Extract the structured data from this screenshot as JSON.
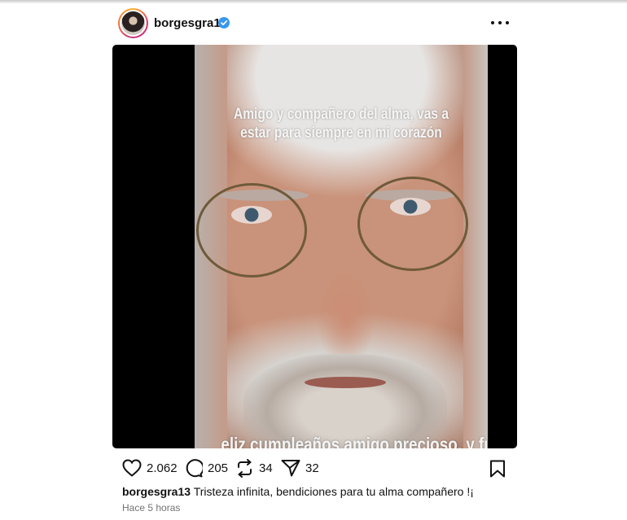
{
  "post": {
    "username": "borgesgra13",
    "verified_color": "#3897f0",
    "media": {
      "overlay_top": "Amigo y compañero del alma, vas a estar para siempre en mi corazón",
      "overlay_bottom": "eliz cumpleaños amigo precioso, y fuerza!!"
    },
    "actions": {
      "likes": "2.062",
      "comments": "205",
      "reposts": "34",
      "shares": "32"
    },
    "caption": {
      "username": "borgesgra13",
      "text": "Tristeza infinita, bendiciones para tu alma compañero !¡"
    },
    "time": "Hace 5 horas"
  },
  "icons": [
    "more-icon",
    "verified-icon",
    "heart-icon",
    "comment-icon",
    "repost-icon",
    "share-icon",
    "bookmark-icon"
  ]
}
